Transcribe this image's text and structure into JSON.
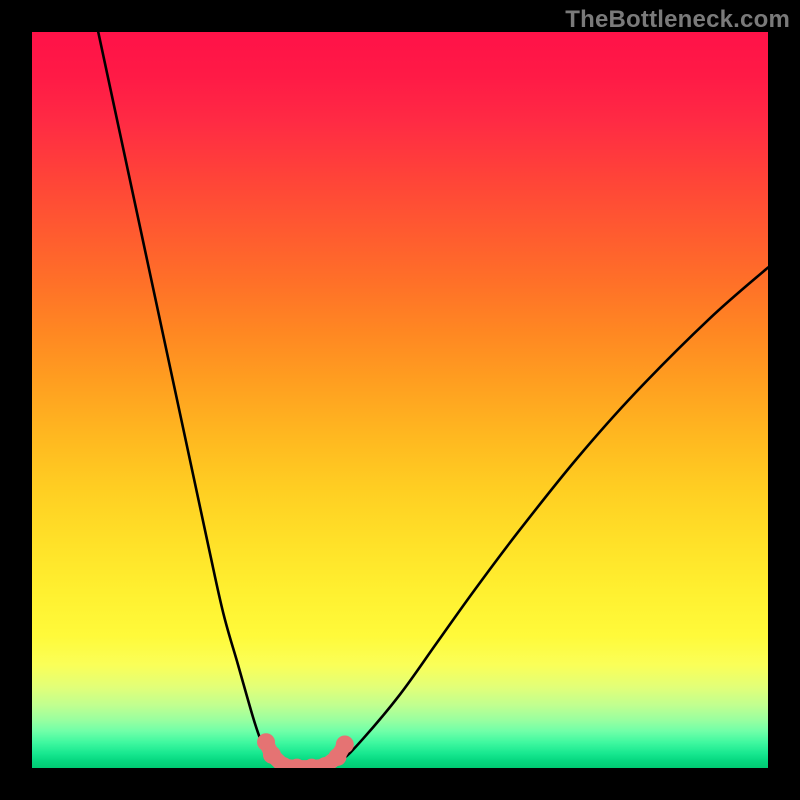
{
  "attribution": "TheBottleneck.com",
  "palette": {
    "frame": "#000000",
    "curve": "#000000",
    "marker_fill": "#e57373",
    "marker_stroke": "#c85a5a",
    "gradient_top": "#ff1248",
    "gradient_bottom": "#00ca72"
  },
  "chart_data": {
    "type": "line",
    "title": "",
    "xlabel": "",
    "ylabel": "",
    "xlim": [
      0,
      100
    ],
    "ylim": [
      0,
      100
    ],
    "series": [
      {
        "name": "left-branch",
        "x": [
          9,
          12,
          15,
          18,
          21,
          24,
          26,
          28,
          30,
          31,
          32,
          33,
          34
        ],
        "y": [
          100,
          86,
          72,
          58,
          44,
          30,
          21,
          14,
          7,
          4,
          2,
          1,
          0.2
        ]
      },
      {
        "name": "right-branch",
        "x": [
          40,
          42,
          45,
          50,
          55,
          60,
          66,
          74,
          82,
          92,
          100
        ],
        "y": [
          0.2,
          1,
          4,
          10,
          17,
          24,
          32,
          42,
          51,
          61,
          68
        ]
      },
      {
        "name": "bottom-flat",
        "x": [
          34,
          36,
          38,
          40
        ],
        "y": [
          0.2,
          0.05,
          0.05,
          0.2
        ]
      }
    ],
    "markers": [
      {
        "x": 31.8,
        "y": 3.5
      },
      {
        "x": 32.6,
        "y": 1.8
      },
      {
        "x": 34.2,
        "y": 0.25
      },
      {
        "x": 36.0,
        "y": 0.05
      },
      {
        "x": 38.0,
        "y": 0.05
      },
      {
        "x": 39.8,
        "y": 0.25
      },
      {
        "x": 41.5,
        "y": 1.5
      },
      {
        "x": 42.5,
        "y": 3.2
      }
    ],
    "notes": "Axes and tick marks are not visible in the image; values are read off the curve positions relative to the plot frame and expressed as 0–100 percentages of frame width (x) and height (y, rendered from bottom)."
  }
}
